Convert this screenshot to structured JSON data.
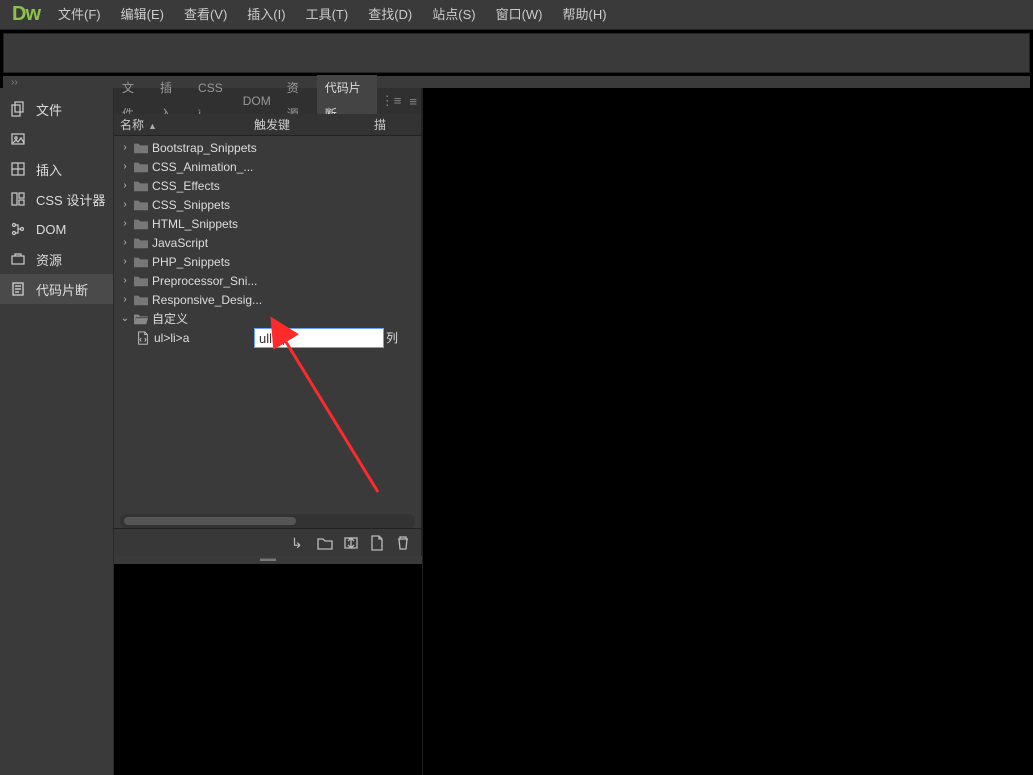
{
  "app": {
    "logo": "Dw"
  },
  "menu": {
    "items": [
      "文件(F)",
      "编辑(E)",
      "查看(V)",
      "插入(I)",
      "工具(T)",
      "查找(D)",
      "站点(S)",
      "窗口(W)",
      "帮助(H)"
    ]
  },
  "expander_glyph": "››",
  "left_panel": {
    "items": [
      {
        "label": "文件",
        "icon": "files-icon"
      },
      {
        "label": "",
        "icon": "image-icon"
      },
      {
        "label": "插入",
        "icon": "insert-icon"
      },
      {
        "label": "CSS 设计器",
        "icon": "css-designer-icon"
      },
      {
        "label": "DOM",
        "icon": "dom-icon"
      },
      {
        "label": "资源",
        "icon": "assets-icon"
      },
      {
        "label": "代码片断",
        "icon": "snippets-icon",
        "active": true
      }
    ]
  },
  "panel": {
    "tabs": [
      "文件",
      "插入",
      "CSS ì",
      "DOM",
      "资源",
      "代码片断"
    ],
    "active_tab": "代码片断",
    "opts_sep": "⋮≡",
    "opt_menu": "≡",
    "columns": {
      "name": "名称",
      "trigger": "触发键",
      "desc": "描"
    },
    "tree": [
      {
        "kind": "folder",
        "label": "Bootstrap_Snippets",
        "expanded": false
      },
      {
        "kind": "folder",
        "label": "CSS_Animation_...",
        "expanded": false
      },
      {
        "kind": "folder",
        "label": "CSS_Effects",
        "expanded": false
      },
      {
        "kind": "folder",
        "label": "CSS_Snippets",
        "expanded": false
      },
      {
        "kind": "folder",
        "label": "HTML_Snippets",
        "expanded": false
      },
      {
        "kind": "folder",
        "label": "JavaScript",
        "expanded": false
      },
      {
        "kind": "folder",
        "label": "PHP_Snippets",
        "expanded": false
      },
      {
        "kind": "folder",
        "label": "Preprocessor_Sni...",
        "expanded": false
      },
      {
        "kind": "folder",
        "label": "Responsive_Desig...",
        "expanded": false
      },
      {
        "kind": "folder",
        "label": "自定义",
        "expanded": true
      },
      {
        "kind": "file",
        "label": "ul>li>a",
        "parent": "自定义"
      }
    ],
    "edit_value": "ullia",
    "after_edit_label": "列",
    "footer_icons": [
      "insert-snippet-icon",
      "new-folder-icon",
      "sync-icon",
      "new-snippet-icon",
      "trash-icon"
    ]
  }
}
